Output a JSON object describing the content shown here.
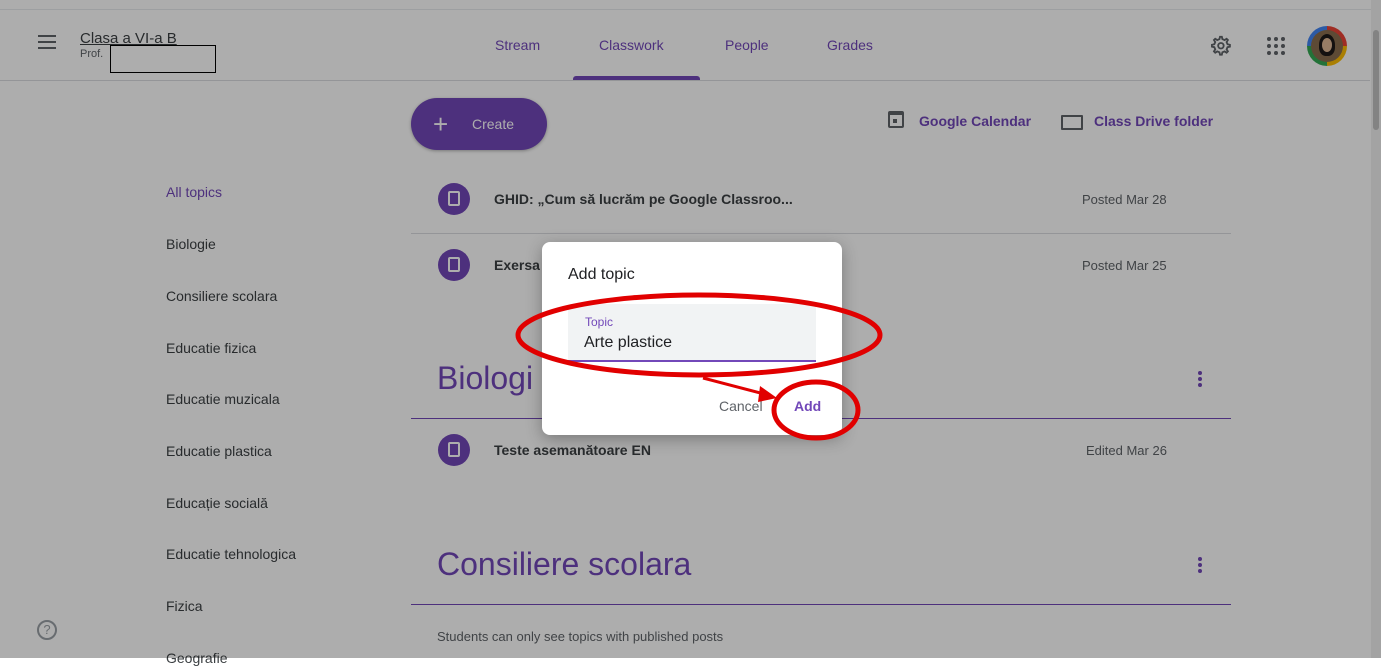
{
  "header": {
    "class_title": "Clasa a VI-a B",
    "class_subtitle": "Prof.",
    "tabs": [
      {
        "label": "Stream"
      },
      {
        "label": "Classwork"
      },
      {
        "label": "People"
      },
      {
        "label": "Grades"
      }
    ],
    "active_tab": "Classwork"
  },
  "toolbar": {
    "create_label": "Create",
    "calendar_label": "Google Calendar",
    "drive_label": "Class Drive folder"
  },
  "topics": {
    "items": [
      "All topics",
      "Biologie",
      "Consiliere scolara",
      "Educatie fizica",
      "Educatie muzicala",
      "Educatie plastica",
      "Educație socială",
      "Educatie tehnologica",
      "Fizica",
      "Geografie"
    ],
    "active": "All topics"
  },
  "posts": [
    {
      "title": "GHID: „Cum să lucrăm pe Google Classroo...",
      "date": "Posted Mar 28",
      "icon": "material-icon"
    },
    {
      "title": "Exersa",
      "date": "Posted Mar 25",
      "icon": "assignment-icon"
    }
  ],
  "sections": [
    {
      "title": "Biologi",
      "posts": [
        {
          "title": "Teste asemanătoare EN",
          "date": "Edited Mar 26",
          "icon": "material-icon"
        }
      ]
    },
    {
      "title": "Consiliere scolara",
      "posts": []
    }
  ],
  "footnote": "Students can only see topics with published posts",
  "dialog": {
    "title": "Add topic",
    "field_label": "Topic",
    "field_value": "Arte plastice",
    "cancel_label": "Cancel",
    "add_label": "Add"
  },
  "colors": {
    "accent": "#7248b9",
    "annotation": "#e10000",
    "scrim": "rgba(0,0,0,0.32)"
  }
}
